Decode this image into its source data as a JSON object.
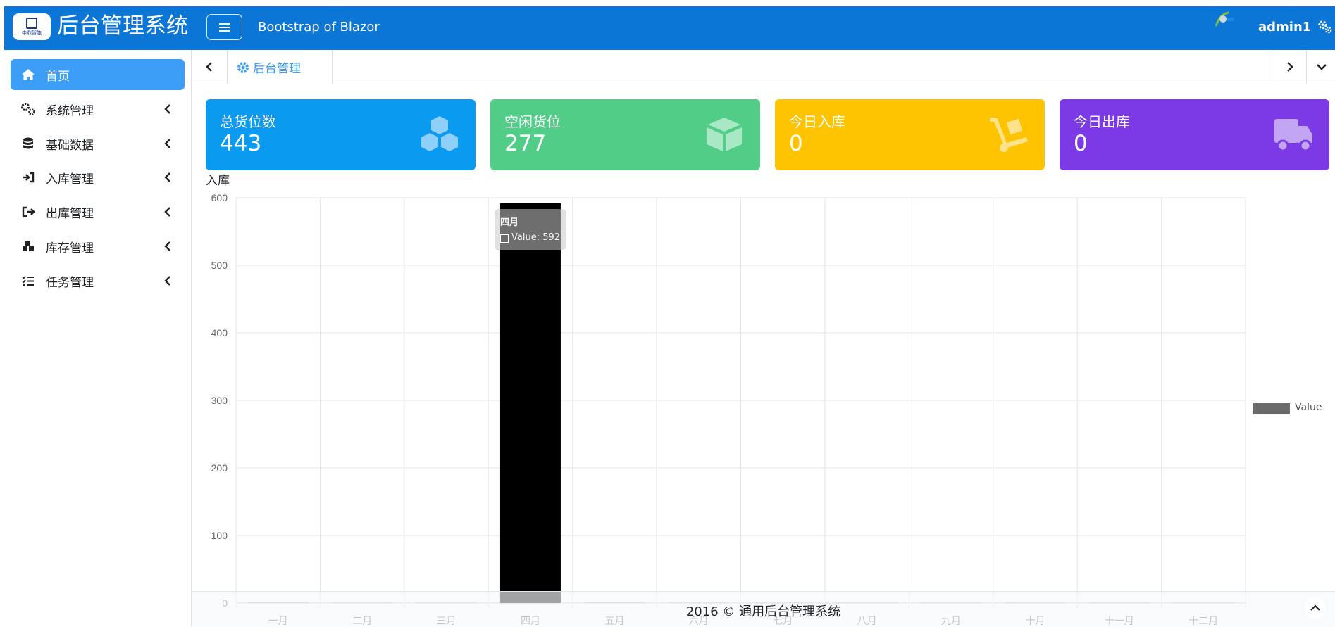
{
  "header": {
    "logo_text": "中鼎智能",
    "app_title": "后台管理系统",
    "subtitle": "Bootstrap of Blazor",
    "username": "admin1",
    "icons": [
      "menu-icon",
      "avatar-icon",
      "gear-icon"
    ],
    "background": "#0b76d6"
  },
  "sidebar": {
    "items": [
      {
        "label": "首页",
        "icon": "home-icon",
        "active": true
      },
      {
        "label": "系统管理",
        "icon": "gears-icon"
      },
      {
        "label": "基础数据",
        "icon": "database-icon"
      },
      {
        "label": "入库管理",
        "icon": "sign-in-icon"
      },
      {
        "label": "出库管理",
        "icon": "sign-out-icon"
      },
      {
        "label": "库存管理",
        "icon": "cubes-icon"
      },
      {
        "label": "任务管理",
        "icon": "list-check-icon"
      }
    ],
    "active_color": "#3c9ef6"
  },
  "tabs": {
    "items": [
      {
        "label": "后台管理",
        "icon": "gear-icon"
      }
    ]
  },
  "stats": [
    {
      "label": "总货位数",
      "value": "443",
      "color": "#0a9af0",
      "icon": "cubes-icon"
    },
    {
      "label": "空闲货位",
      "value": "277",
      "color": "#52cd88",
      "icon": "box-open-icon"
    },
    {
      "label": "今日入库",
      "value": "0",
      "color": "#fec301",
      "icon": "dolly-icon"
    },
    {
      "label": "今日出库",
      "value": "0",
      "color": "#7c3ae6",
      "icon": "truck-icon"
    }
  ],
  "chart": {
    "title": "入库",
    "tooltip": {
      "title": "四月",
      "text": "Value: 592"
    }
  },
  "chart_data": {
    "type": "bar",
    "title": "入库",
    "categories": [
      "一月",
      "二月",
      "三月",
      "四月",
      "五月",
      "六月",
      "七月",
      "八月",
      "九月",
      "十月",
      "十一月",
      "十二月"
    ],
    "series": [
      {
        "name": "Value",
        "values": [
          1,
          0,
          0,
          592,
          1,
          0,
          0,
          0,
          0,
          0,
          0,
          0
        ]
      }
    ],
    "yticks": [
      0,
      100,
      200,
      300,
      400,
      500,
      600
    ],
    "ylim": [
      0,
      600
    ],
    "grid": true,
    "legend": "right",
    "colors": {
      "bar": "#6b6b6b",
      "highlight": "#000000"
    }
  },
  "footer": {
    "text": "2016 © 通用后台管理系统"
  }
}
